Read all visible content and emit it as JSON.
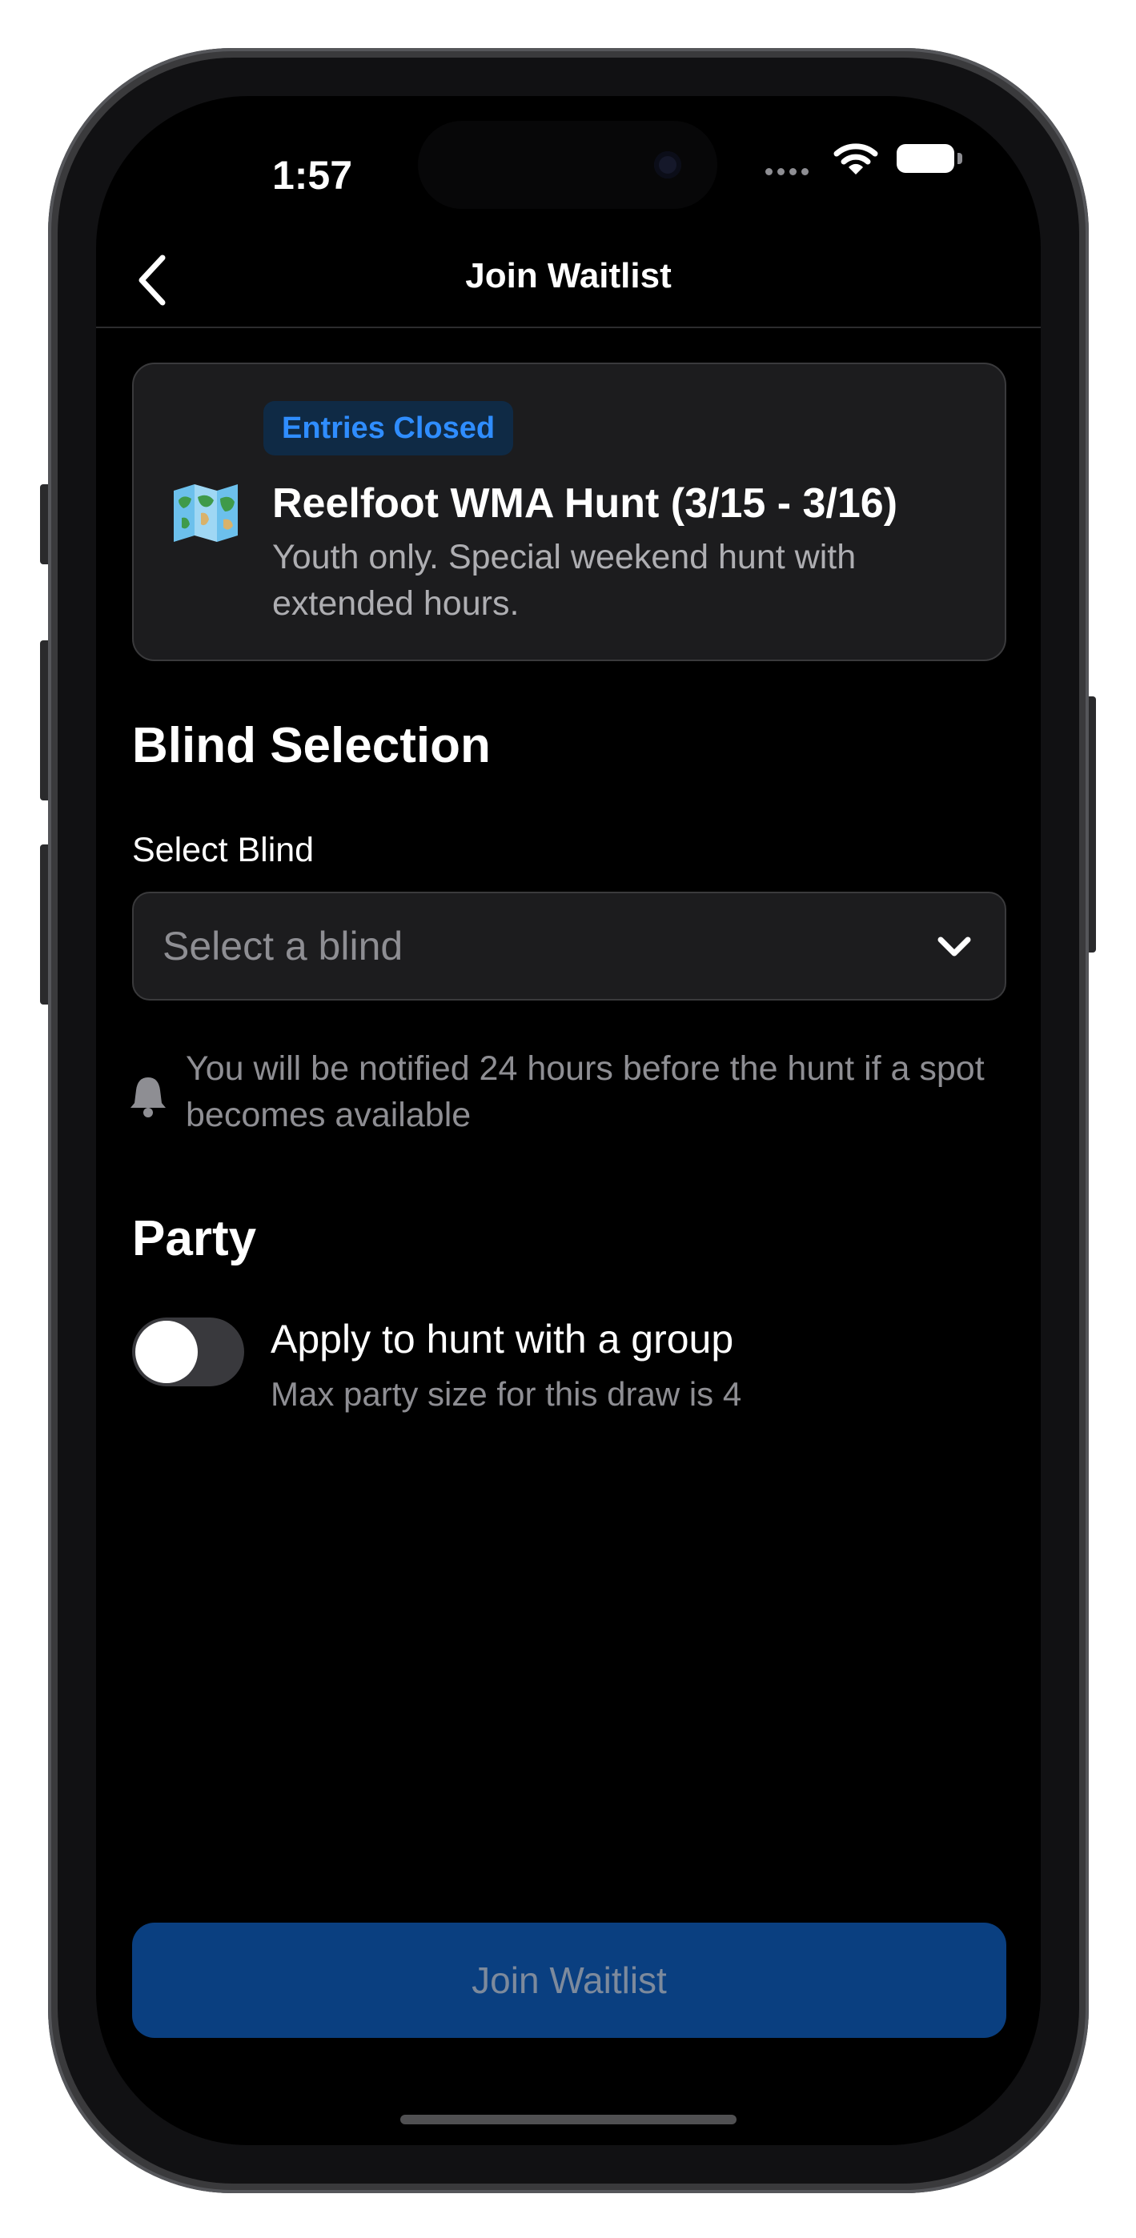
{
  "status_bar": {
    "time": "1:57",
    "wifi_icon": "wifi-icon",
    "battery_icon": "battery-icon"
  },
  "nav": {
    "title": "Join Waitlist",
    "back_icon": "chevron-left-icon"
  },
  "hunt_card": {
    "status": "Entries Closed",
    "icon": "world-map-icon",
    "title": "Reelfoot WMA Hunt (3/15 - 3/16)",
    "description": "Youth only. Special weekend hunt with extended hours."
  },
  "blind_section": {
    "heading": "Blind Selection",
    "field_label": "Select Blind",
    "select_placeholder": "Select a blind",
    "select_icon": "chevron-down-icon",
    "notification_icon": "bell-icon",
    "notification_text": "You will be notified 24 hours before the hunt if a spot becomes available"
  },
  "party_section": {
    "heading": "Party",
    "toggle_on": false,
    "toggle_label": "Apply to hunt with a group",
    "hint": "Max party size for this draw is 4"
  },
  "footer": {
    "join_button_label": "Join Waitlist"
  },
  "colors": {
    "background": "#000000",
    "card": "#1c1c1e",
    "badge_text": "#2f8dff",
    "primary_button": "#0a3f80"
  }
}
